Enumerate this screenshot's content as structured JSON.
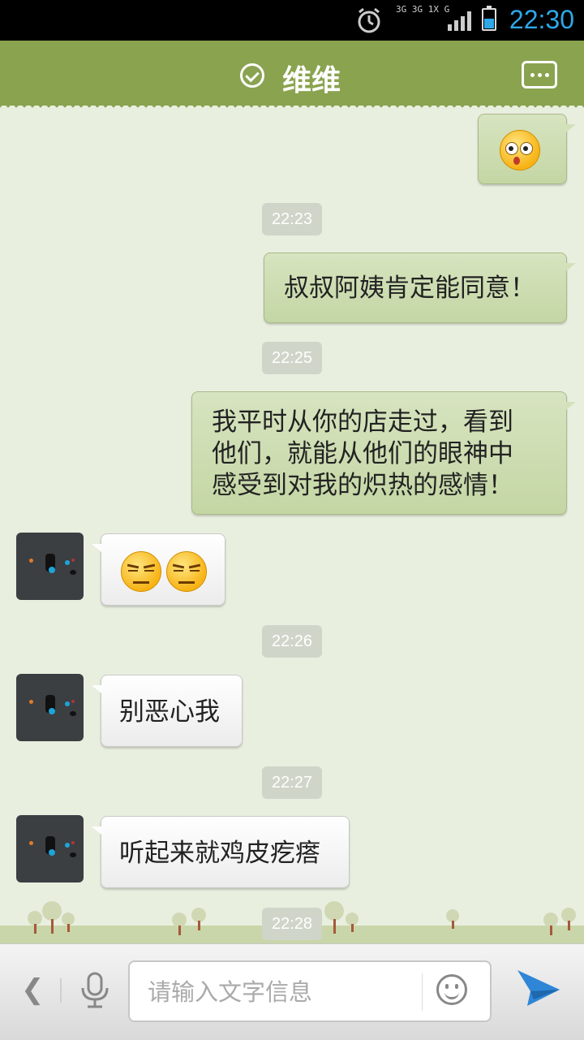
{
  "status_bar": {
    "network_top": "3G 3G 1X G",
    "time": "22:30"
  },
  "header": {
    "title": "维维",
    "verified_icon": "check-circle-icon",
    "menu_icon": "more-icon"
  },
  "messages": [
    {
      "type": "emoji",
      "sender": "me",
      "emoji": [
        "surprised-face-emoji"
      ]
    },
    {
      "type": "time",
      "text": "22:23"
    },
    {
      "type": "text",
      "sender": "me",
      "text": "叔叔阿姨肯定能同意！"
    },
    {
      "type": "time",
      "text": "22:25"
    },
    {
      "type": "text",
      "sender": "me",
      "lines": [
        "我平时从你的店走过，看到",
        "他们，就能从他们的眼神中",
        "感受到对我的炽热的感情！"
      ]
    },
    {
      "type": "emoji",
      "sender": "other",
      "emoji": [
        "smug-thumbs-emoji",
        "smug-thumbs-emoji"
      ]
    },
    {
      "type": "time",
      "text": "22:26"
    },
    {
      "type": "text",
      "sender": "other",
      "text": "别恶心我"
    },
    {
      "type": "time",
      "text": "22:27"
    },
    {
      "type": "text",
      "sender": "other",
      "text": "听起来就鸡皮疙瘩"
    },
    {
      "type": "time",
      "text": "22:28"
    }
  ],
  "input_bar": {
    "placeholder": "请输入文字信息",
    "back_icon": "chevron-left-icon",
    "voice_icon": "microphone-icon",
    "emoji_icon": "smiley-icon",
    "send_icon": "send-plane-icon"
  },
  "colors": {
    "header": "#8aa34f",
    "background": "#e9efdf",
    "my_bubble": "#cfdcb5",
    "other_bubble": "#ffffff",
    "clock": "#2ea8e8"
  }
}
